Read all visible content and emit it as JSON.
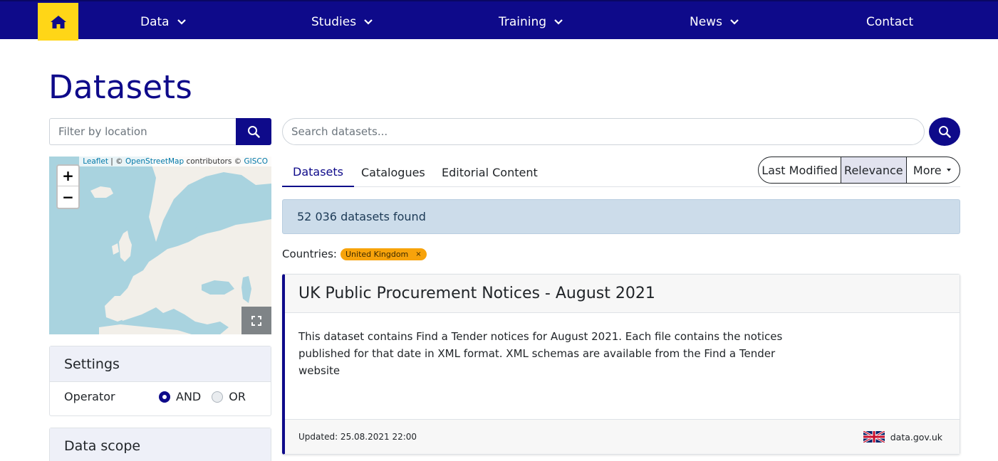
{
  "nav": {
    "items": [
      {
        "label": "Data",
        "dropdown": true
      },
      {
        "label": "Studies",
        "dropdown": true
      },
      {
        "label": "Training",
        "dropdown": true
      },
      {
        "label": "News",
        "dropdown": true
      },
      {
        "label": "Contact",
        "dropdown": false
      }
    ]
  },
  "page": {
    "title": "Datasets"
  },
  "filters": {
    "location_placeholder": "Filter by location",
    "map_attribution": {
      "leaflet": "Leaflet",
      "sep1": " | © ",
      "osm": "OpenStreetMap",
      "contrib": " contributors © ",
      "gisco": "GISCO"
    },
    "settings_title": "Settings",
    "operator_label": "Operator",
    "operator_options": [
      "AND",
      "OR"
    ],
    "operator_selected": "AND",
    "data_scope_title": "Data scope"
  },
  "search": {
    "placeholder": "Search datasets..."
  },
  "tabs": [
    "Datasets",
    "Catalogues",
    "Editorial Content"
  ],
  "active_tab": "Datasets",
  "sort": {
    "options": [
      "Last Modified",
      "Relevance",
      "More"
    ],
    "selected": "Relevance"
  },
  "results": {
    "count_text": "52 036 datasets found",
    "countries_label": "Countries:",
    "country_chip": "United Kingdom",
    "chip_remove": "×",
    "items": [
      {
        "title": "UK Public Procurement Notices - August 2021",
        "description": "This dataset contains Find a Tender notices for August 2021. Each file contains the notices published for that date in XML format. XML schemas are available from the Find a Tender website",
        "updated": "Updated: 25.08.2021 22:00",
        "publisher": "data.gov.uk",
        "flag": "uk-flag-icon"
      }
    ]
  },
  "colors": {
    "primary": "#0e0a8a",
    "home_bg": "#ffd617",
    "chip": "#f7a30b",
    "alert_bg": "#ccdcea"
  }
}
